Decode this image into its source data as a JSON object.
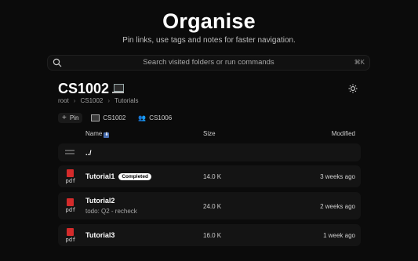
{
  "hero": {
    "title": "Organise",
    "subtitle": "Pin links, use tags and notes for faster navigation."
  },
  "search": {
    "placeholder": "Search visited folders or run commands",
    "shortcut": "⌘K"
  },
  "folder": {
    "title": "CS1002",
    "breadcrumb": [
      "root",
      "CS1002",
      "Tutorials"
    ]
  },
  "chips": [
    {
      "label": "Pin"
    },
    {
      "label": "CS1002"
    },
    {
      "label": "CS1006"
    }
  ],
  "table": {
    "headers": {
      "name": "Name",
      "size": "Size",
      "modified": "Modified"
    },
    "sort_badge": "⬇",
    "parent_row": {
      "name": "../"
    },
    "rows": [
      {
        "name": "Tutorial1",
        "badge": "Completed",
        "size": "14.0 K",
        "modified": "3 weeks ago",
        "icon_label": "pdf"
      },
      {
        "name": "Tutorial2",
        "note": "todo: Q2 - recheck",
        "size": "24.0 K",
        "modified": "2 weeks ago",
        "icon_label": "pdf"
      },
      {
        "name": "Tutorial3",
        "size": "16.0 K",
        "modified": "1 week ago",
        "icon_label": "pdf"
      }
    ]
  },
  "colors": {
    "background": "#0b0b0b",
    "row_bg": "#141414",
    "pdf_red": "#d42b2b"
  }
}
